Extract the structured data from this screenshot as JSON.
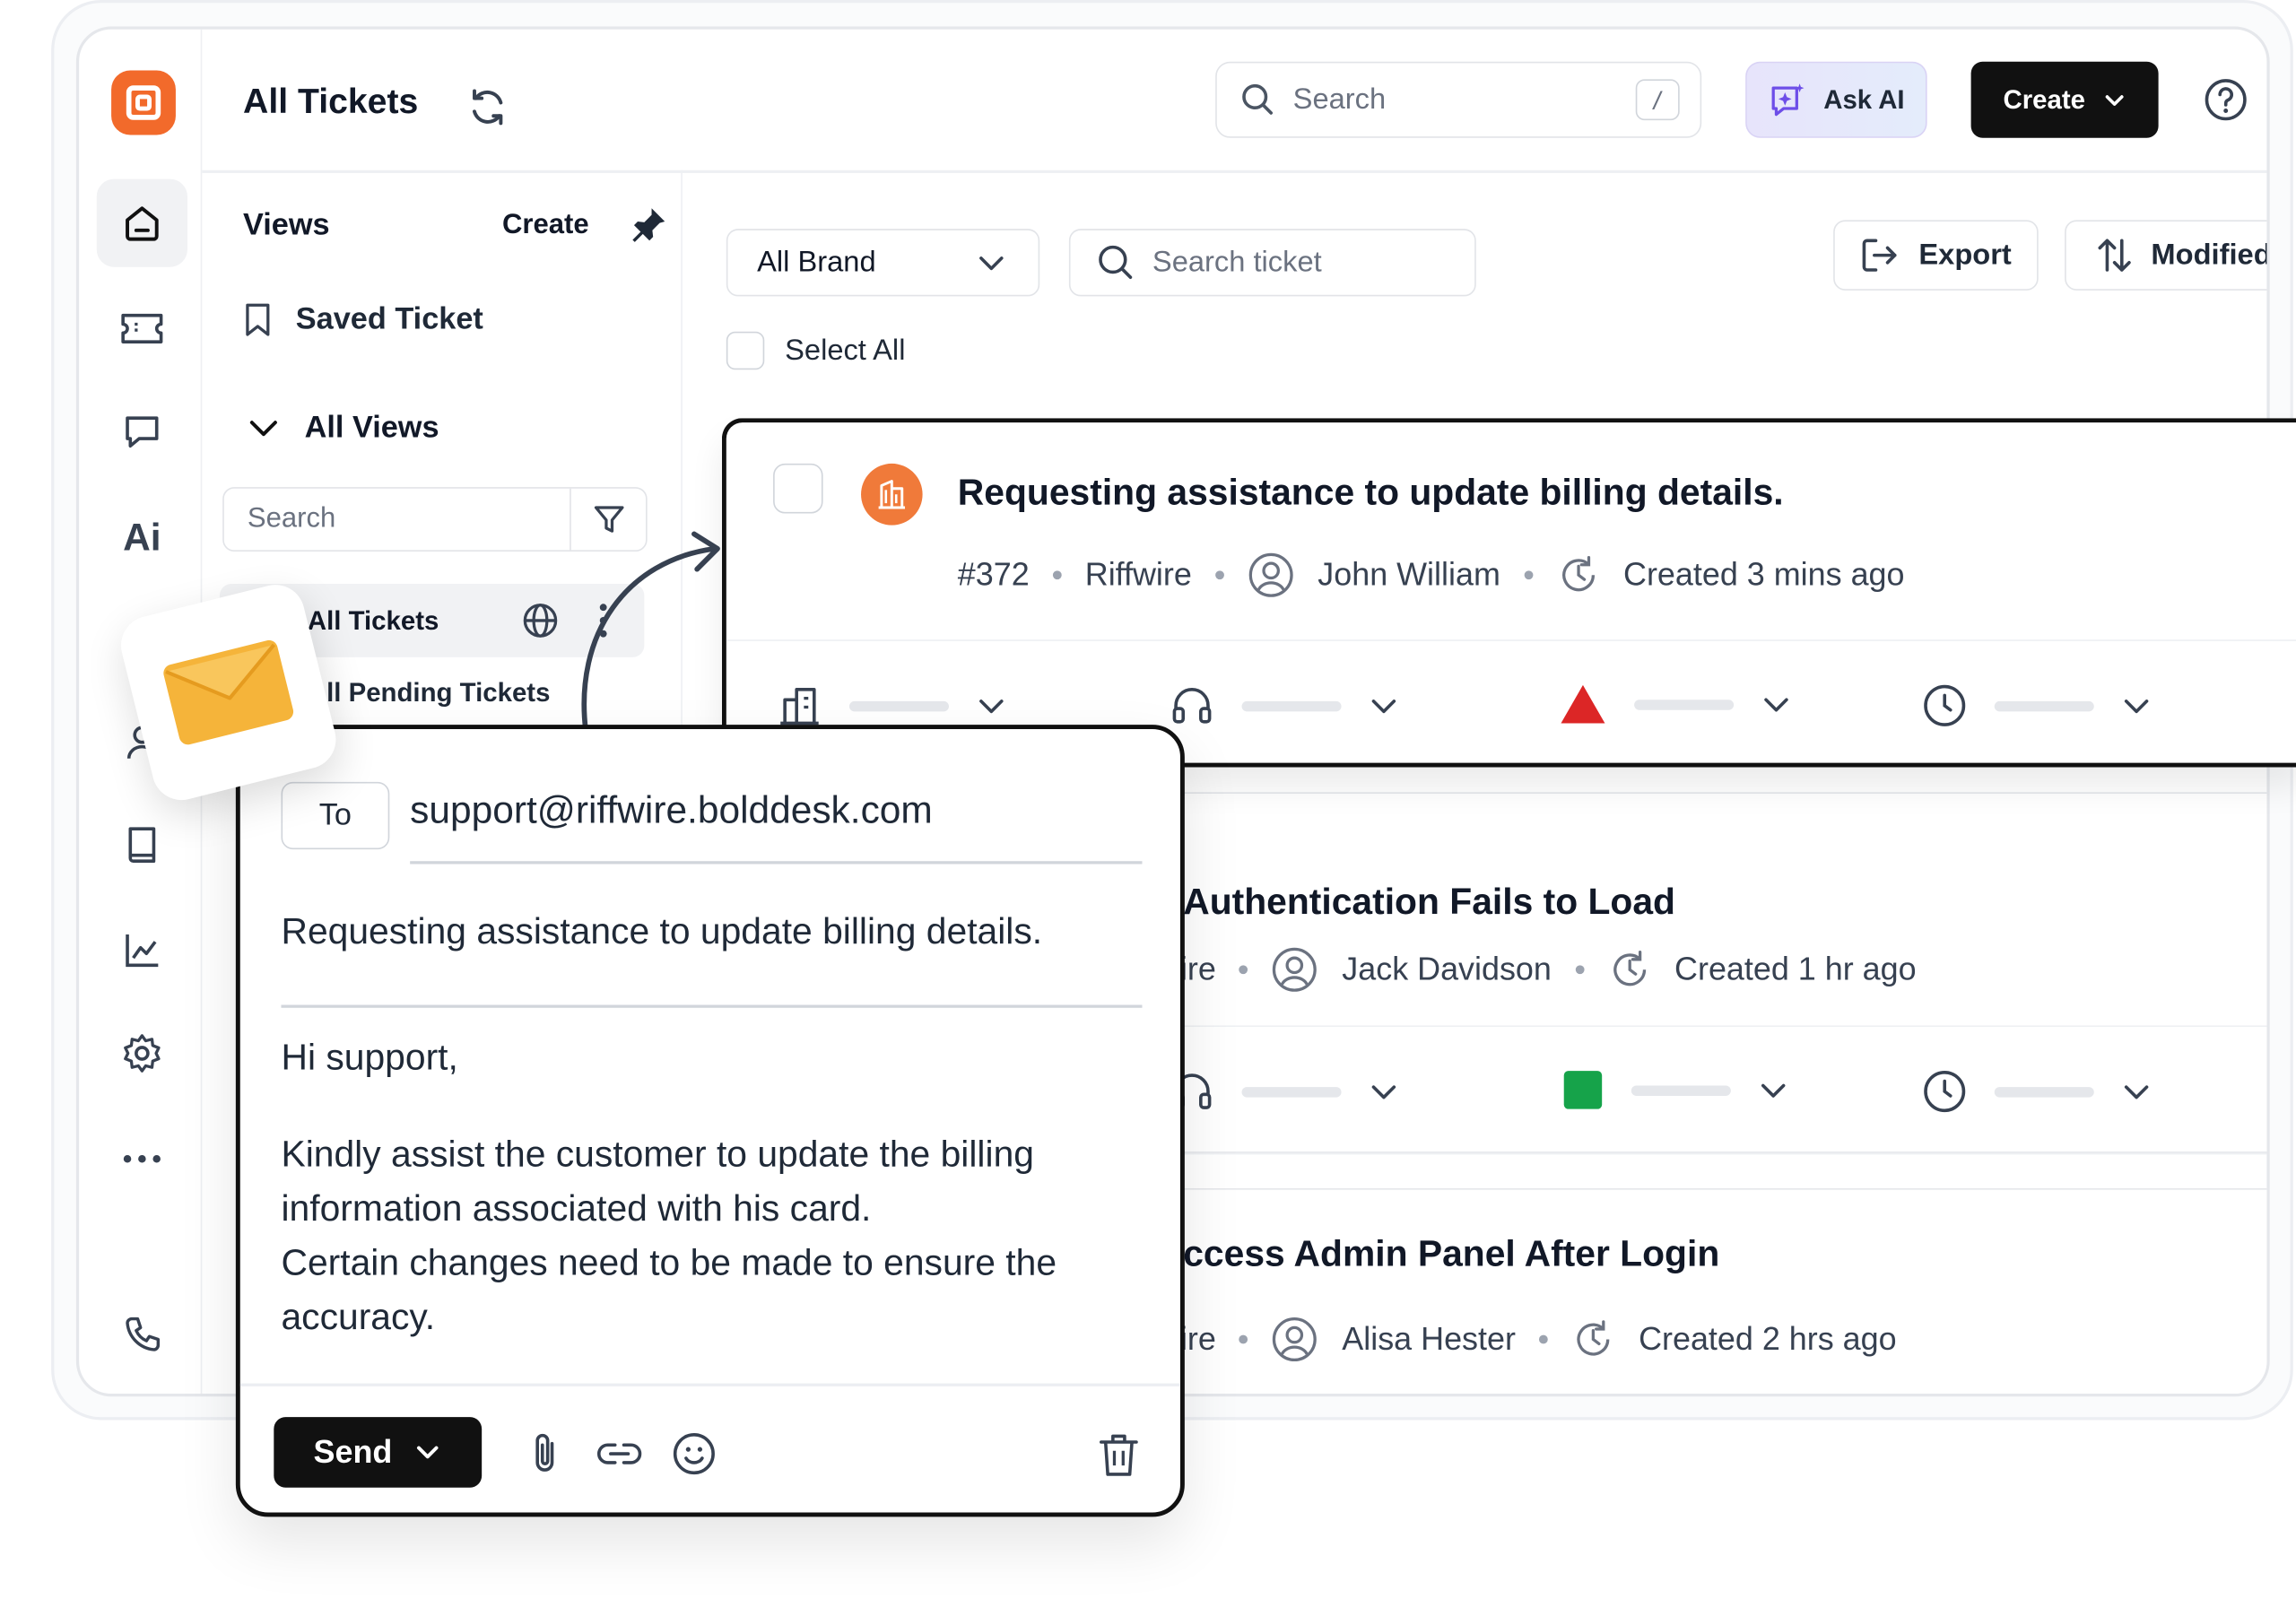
{
  "header": {
    "title": "All Tickets",
    "search_placeholder": "Search",
    "search_shortcut": "/",
    "ask_ai_label": "Ask AI",
    "create_label": "Create"
  },
  "views": {
    "title": "Views",
    "create_label": "Create",
    "saved_label": "Saved Ticket",
    "all_views_label": "All Views",
    "search_placeholder": "Search",
    "items": [
      {
        "label": "All Tickets"
      },
      {
        "label": "All Pending Tickets"
      }
    ]
  },
  "toolbar": {
    "brand_filter": "All Brand",
    "ticket_search_placeholder": "Search ticket",
    "export_label": "Export",
    "sort_label": "Modified",
    "select_all_label": "Select All"
  },
  "tickets": [
    {
      "title": "Requesting assistance to update billing details.",
      "id": "#372",
      "brand": "Riffwire",
      "contact": "John William",
      "created": "Created 3 mins ago",
      "priority_color": "#dc2626"
    },
    {
      "title": "Authentication Fails to Load",
      "brand": "ire",
      "contact": "Jack Davidson",
      "created": "Created 1 hr ago",
      "priority_color": "#16a34a"
    },
    {
      "title": "ccess Admin Panel After Login",
      "brand": "ire",
      "contact": "Alisa Hester",
      "created": "Created 2 hrs ago"
    }
  ],
  "compose": {
    "to_label": "To",
    "to_address": "support@riffwire.bolddesk.com",
    "subject": "Requesting assistance to update billing details.",
    "greeting": "Hi support,",
    "body_line1": "Kindly assist the customer to update the billing information associated with his card.",
    "body_line2": "Certain changes need to be made to ensure the accuracy.",
    "send_label": "Send"
  },
  "colors": {
    "brand_orange": "#f26a2b",
    "dark": "#111111",
    "mail_yellow": "#f5b43a"
  }
}
